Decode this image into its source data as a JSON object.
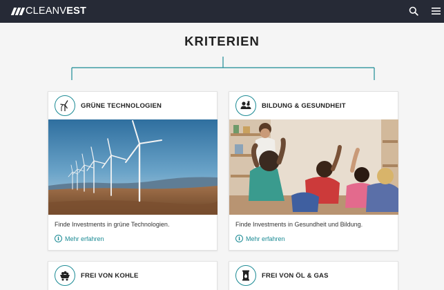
{
  "header": {
    "logo": {
      "light": "CLEANV",
      "bold": "EST"
    },
    "search_icon": "search-icon",
    "menu_icon": "hamburger-menu-icon"
  },
  "page": {
    "title": "KRITERIEN"
  },
  "colors": {
    "accent": "#1a8a94",
    "topbar": "#262a36",
    "background": "#f5f5f5"
  },
  "cards": [
    {
      "title": "GRÜNE TECHNOLOGIEN",
      "icon": "wind-turbine-icon",
      "image": "wind-turbines-photo",
      "description": "Finde Investments in grüne Technologien.",
      "link": "Mehr erfahren"
    },
    {
      "title": "BILDUNG & GESUNDHEIT",
      "icon": "people-group-icon",
      "image": "classroom-children-photo",
      "description": "Finde Investments in Gesundheit und Bildung.",
      "link": "Mehr erfahren"
    },
    {
      "title": "FREI VON KOHLE",
      "icon": "coal-cart-icon"
    },
    {
      "title": "FREI VON ÖL & GAS",
      "icon": "oil-barrel-icon"
    }
  ]
}
